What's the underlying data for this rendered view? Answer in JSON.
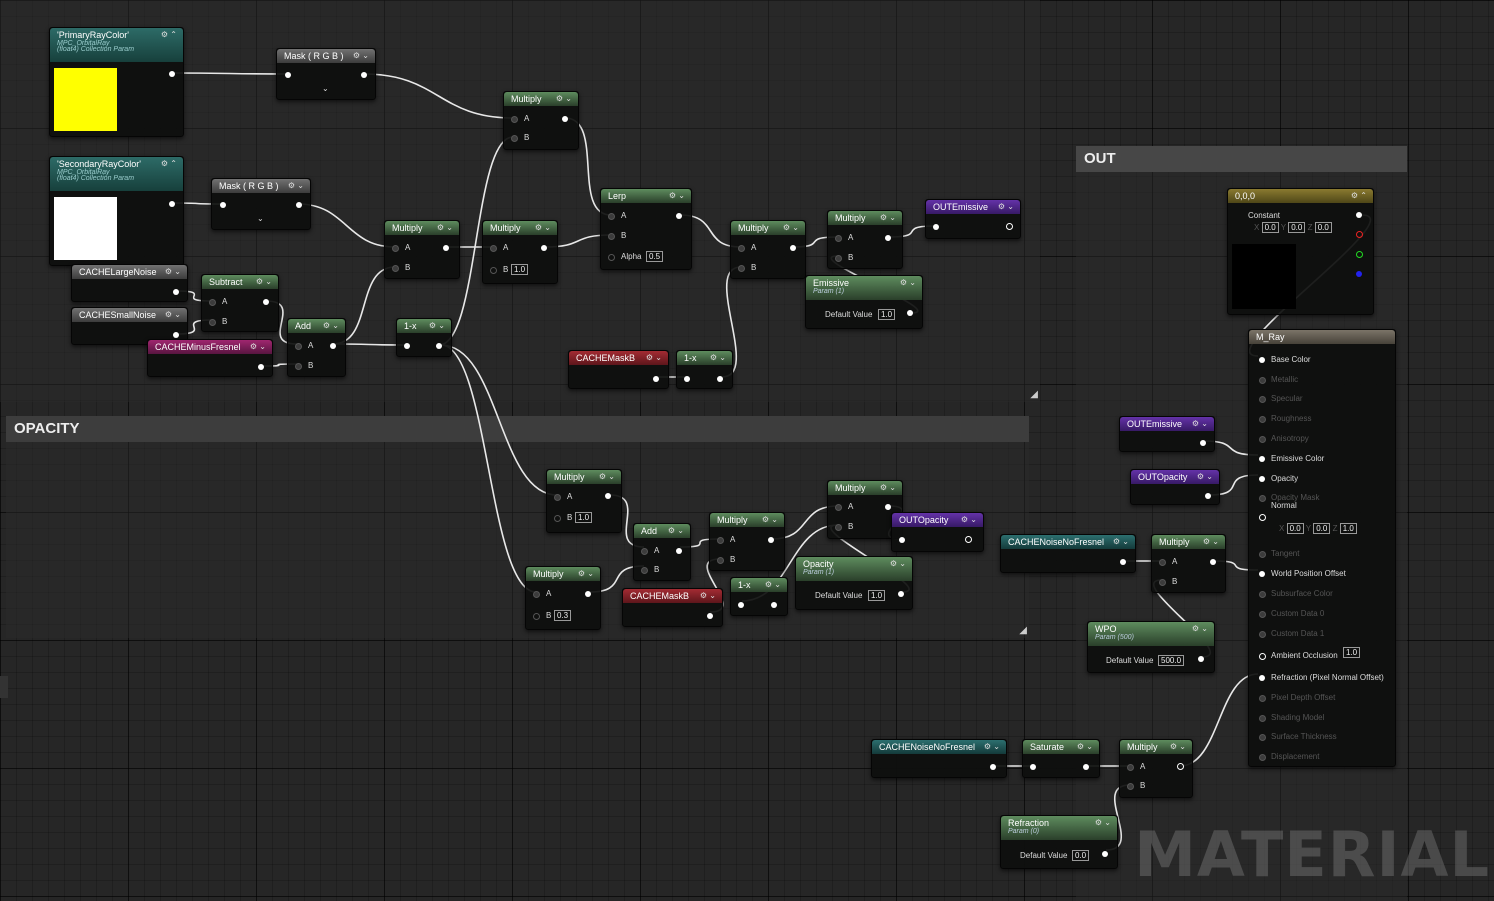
{
  "comments": {
    "opacity": "OPACITY",
    "out": "OUT"
  },
  "watermark": "MATERIAL",
  "icons": {
    "pin_options": "settings-icon",
    "chevron": "chevron-down-icon",
    "collapse": "chevron-up-icon"
  },
  "nodes": {
    "primary_ray_color": {
      "title": "'PrimaryRayColor'",
      "sub1": "MPC_OrbitalRay",
      "sub2": "(float4) Collection Param",
      "color": "#ffff00"
    },
    "secondary_ray_color": {
      "title": "'SecondaryRayColor'",
      "sub1": "MPC_OrbitalRay",
      "sub2": "(float4) Collection Param",
      "color": "#ffffff"
    },
    "mask1": {
      "title": "Mask ( R G B )"
    },
    "mask2": {
      "title": "Mask ( R G B )"
    },
    "cache_large_noise": {
      "title": "CACHELargeNoise"
    },
    "cache_small_noise": {
      "title": "CACHESmallNoise"
    },
    "subtract": {
      "title": "Subtract",
      "a": "A",
      "b": "B"
    },
    "cache_minus_fresnel": {
      "title": "CACHEMinusFresnel"
    },
    "add1": {
      "title": "Add",
      "a": "A",
      "b": "B"
    },
    "multiply1": {
      "title": "Multiply",
      "a": "A",
      "b": "B"
    },
    "multiply2": {
      "title": "Multiply",
      "a": "A",
      "b": "B"
    },
    "one_minus1": {
      "title": "1-x"
    },
    "multiply3": {
      "title": "Multiply",
      "a": "A",
      "b": "B",
      "b_value": "1.0"
    },
    "lerp": {
      "title": "Lerp",
      "a": "A",
      "b": "B",
      "alpha": "Alpha",
      "alpha_value": "0.5"
    },
    "multiply4": {
      "title": "Multiply",
      "a": "A",
      "b": "B"
    },
    "multiply5": {
      "title": "Multiply",
      "a": "A",
      "b": "B"
    },
    "out_emissive1": {
      "title": "OUTEmissive"
    },
    "emissive_param": {
      "title": "Emissive",
      "sub": "Param (1)",
      "label": "Default Value",
      "value": "1.0"
    },
    "cache_maskb1": {
      "title": "CACHEMaskB"
    },
    "one_minus2": {
      "title": "1-x"
    },
    "multiply6": {
      "title": "Multiply",
      "a": "A",
      "b": "B",
      "b_value": "1.0"
    },
    "multiply7": {
      "title": "Multiply",
      "a": "A",
      "b": "B",
      "b_value": "0.3"
    },
    "add2": {
      "title": "Add",
      "a": "A",
      "b": "B"
    },
    "multiply8": {
      "title": "Multiply",
      "a": "A",
      "b": "B"
    },
    "multiply9": {
      "title": "Multiply",
      "a": "A",
      "b": "B"
    },
    "out_opacity1": {
      "title": "OUTOpacity"
    },
    "cache_maskb2": {
      "title": "CACHEMaskB"
    },
    "one_minus3": {
      "title": "1-x"
    },
    "opacity_param": {
      "title": "Opacity",
      "sub": "Param (1)",
      "label": "Default Value",
      "value": "1.0"
    },
    "constant": {
      "title": "0,0,0",
      "label": "Constant",
      "x_label": "X",
      "x": "0.0",
      "y_label": "Y",
      "y": "0.0",
      "z_label": "Z",
      "z": "0.0",
      "color": "#000000"
    },
    "out_emissive2": {
      "title": "OUTEmissive"
    },
    "out_opacity2": {
      "title": "OUTOpacity"
    },
    "cache_noise_no_fresnel1": {
      "title": "CACHENoiseNoFresnel"
    },
    "multiply10": {
      "title": "Multiply",
      "a": "A",
      "b": "B"
    },
    "wpo_param": {
      "title": "WPO",
      "sub": "Param (500)",
      "label": "Default Value",
      "value": "500.0"
    },
    "cache_noise_no_fresnel2": {
      "title": "CACHENoiseNoFresnel"
    },
    "saturate": {
      "title": "Saturate"
    },
    "multiply11": {
      "title": "Multiply",
      "a": "A",
      "b": "B"
    },
    "refraction_param": {
      "title": "Refraction",
      "sub": "Param (0)",
      "label": "Default Value",
      "value": "0.0"
    }
  },
  "material": {
    "title": "M_Ray",
    "inputs": [
      {
        "label": "Base Color",
        "active": true
      },
      {
        "label": "Metallic",
        "active": false
      },
      {
        "label": "Specular",
        "active": false
      },
      {
        "label": "Roughness",
        "active": false
      },
      {
        "label": "Anisotropy",
        "active": false
      },
      {
        "label": "Emissive Color",
        "active": true
      },
      {
        "label": "Opacity",
        "active": true
      },
      {
        "label": "Opacity Mask",
        "active": false
      },
      {
        "label": "Normal",
        "active": true
      },
      {
        "label": "Tangent",
        "active": false
      },
      {
        "label": "World Position Offset",
        "active": true
      },
      {
        "label": "Subsurface Color",
        "active": false
      },
      {
        "label": "Custom Data 0",
        "active": false
      },
      {
        "label": "Custom Data 1",
        "active": false
      },
      {
        "label": "Ambient Occlusion",
        "active": true
      },
      {
        "label": "Refraction (Pixel Normal Offset)",
        "active": true
      },
      {
        "label": "Pixel Depth Offset",
        "active": false
      },
      {
        "label": "Shading Model",
        "active": false
      },
      {
        "label": "Surface Thickness",
        "active": false
      },
      {
        "label": "Displacement",
        "active": false
      }
    ],
    "normal": {
      "x_label": "X",
      "x": "0.0",
      "y_label": "Y",
      "y": "0.0",
      "z_label": "Z",
      "z": "1.0"
    },
    "ambient_occlusion_value": "1.0"
  }
}
